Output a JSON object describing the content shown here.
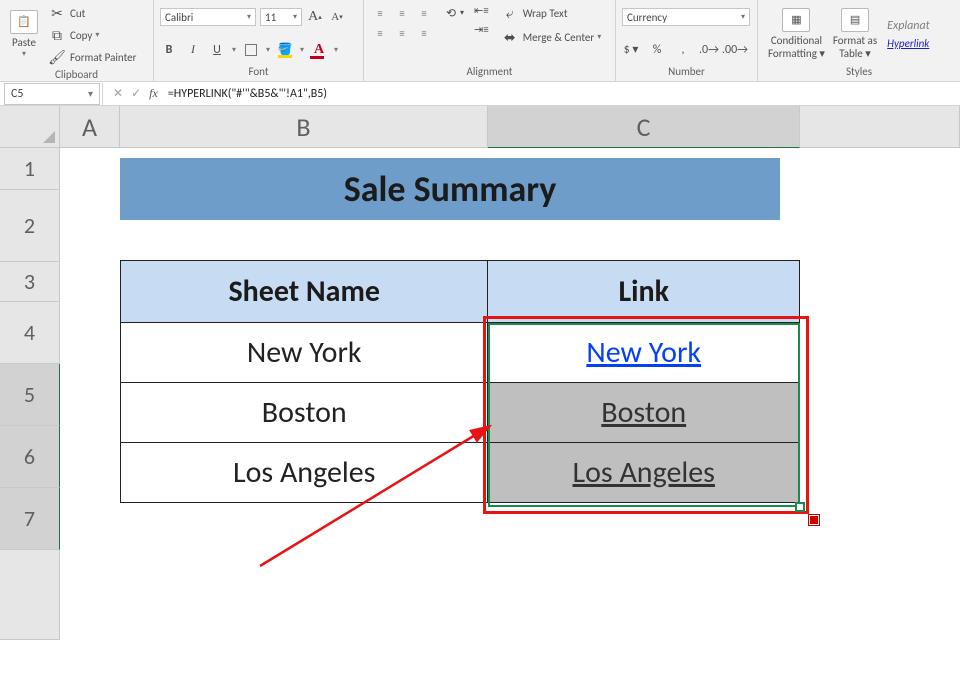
{
  "ribbon": {
    "clipboard": {
      "paste": "Paste",
      "cut": "Cut",
      "copy": "Copy",
      "format_painter": "Format Painter",
      "label": "Clipboard"
    },
    "font": {
      "name": "Calibri",
      "size": "11",
      "increase": "A",
      "decrease": "A",
      "bold": "B",
      "italic": "I",
      "underline": "U",
      "label": "Font"
    },
    "align": {
      "wrap": "Wrap Text",
      "merge": "Merge & Center",
      "label": "Alignment"
    },
    "number": {
      "format": "Currency",
      "label": "Number"
    },
    "styles": {
      "cond": "Conditional",
      "cond2": "Formatting",
      "fmt": "Format as",
      "fmt2": "Table",
      "explan": "Explanat",
      "hyper": "Hyperlink",
      "label": "Styles"
    }
  },
  "formula_bar": {
    "cell_ref": "C5",
    "formula": "=HYPERLINK(\"#'\"&B5&\"'!A1\",B5)"
  },
  "columns": [
    "A",
    "B",
    "C"
  ],
  "rownums": [
    "1",
    "2",
    "3",
    "4",
    "5",
    "6",
    "7"
  ],
  "sheet": {
    "title": "Sale Summary",
    "hdr_sheet": "Sheet Name",
    "hdr_link": "Link",
    "rows": [
      {
        "name": "New York",
        "link": "New York",
        "sel": false
      },
      {
        "name": "Boston",
        "link": "Boston",
        "sel": true
      },
      {
        "name": "Los Angeles",
        "link": "Los Angeles",
        "sel": true
      }
    ]
  }
}
